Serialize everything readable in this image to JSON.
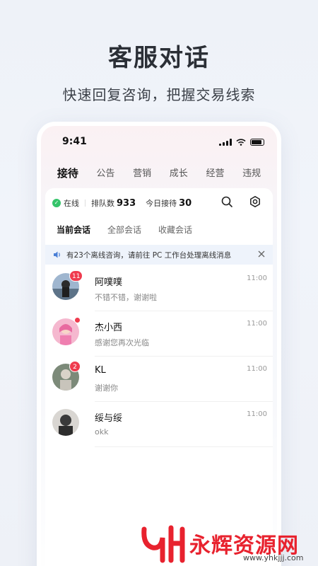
{
  "promo": {
    "title": "客服对话",
    "subtitle": "快速回复咨询，把握交易线索"
  },
  "status_bar": {
    "time": "9:41"
  },
  "top_tabs": [
    {
      "label": "接待",
      "active": true
    },
    {
      "label": "公告"
    },
    {
      "label": "营销"
    },
    {
      "label": "成长"
    },
    {
      "label": "经营"
    },
    {
      "label": "违规"
    }
  ],
  "stats": {
    "online_label": "在线",
    "queue_label": "排队数",
    "queue_count": "933",
    "today_label": "今日接待",
    "today_count": "30"
  },
  "conv_tabs": [
    {
      "label": "当前会话",
      "active": true
    },
    {
      "label": "全部会话"
    },
    {
      "label": "收藏会话"
    }
  ],
  "notice": {
    "text": "有23个离线咨询，请前往 PC 工作台处理离线消息"
  },
  "conversations": [
    {
      "name": "阿噗噗",
      "message": "不错不错，谢谢啦",
      "time": "11:00",
      "badge": "11"
    },
    {
      "name": "杰小西",
      "message": "感谢您再次光临",
      "time": "11:00",
      "badge": ""
    },
    {
      "name": "KL",
      "message": "谢谢你",
      "time": "11:00",
      "badge": "2"
    },
    {
      "name": "绥与绥",
      "message": "okk",
      "time": "11:00",
      "badge": ""
    }
  ],
  "watermark": {
    "text": "永辉资源网",
    "url": "www.yhkjjj.com"
  },
  "colors": {
    "accent_red": "#ef3b4e",
    "online_green": "#35c46a",
    "notice_bg": "#eef3fb"
  }
}
